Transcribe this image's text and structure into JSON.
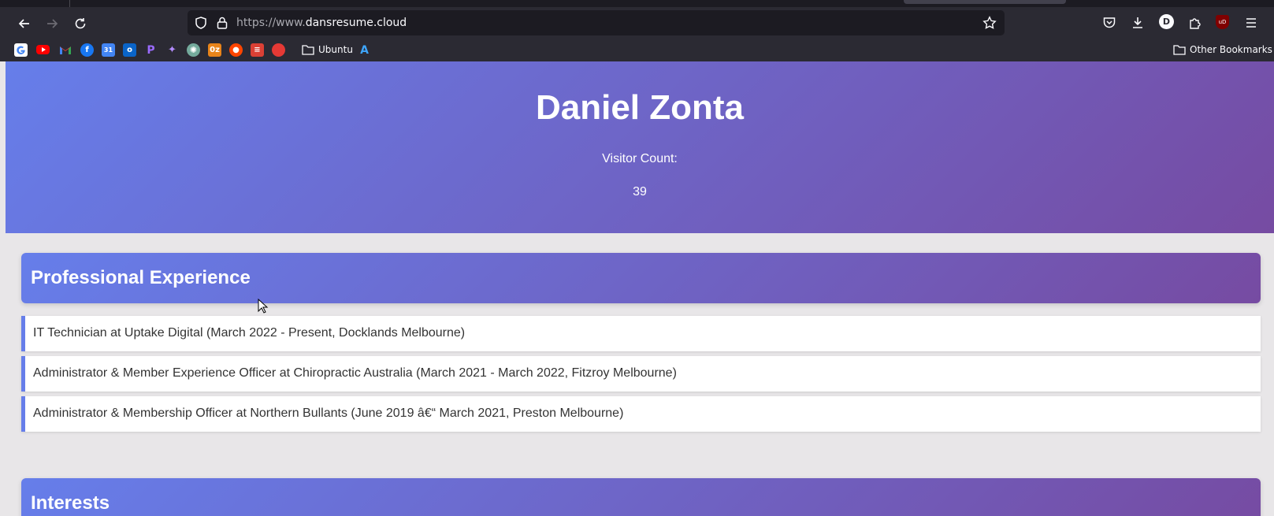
{
  "browser": {
    "url_prefix": "https://www.",
    "url_domain": "dansresume.cloud",
    "profile_initial": "D",
    "ublock_label": "uD",
    "bookmarks": {
      "folders": [
        "Ubuntu"
      ],
      "other_label": "Other Bookmarks"
    }
  },
  "hero": {
    "name": "Daniel Zonta",
    "visitor_label": "Visitor Count:",
    "visitor_count": "39"
  },
  "experience": {
    "title": "Professional Experience",
    "items": [
      "IT Technician at Uptake Digital (March 2022 - Present, Docklands Melbourne)",
      "Administrator & Member Experience Officer at Chiropractic Australia (March 2021 - March 2022, Fitzroy Melbourne)",
      "Administrator & Membership Officer at Northern Bullants (June 2019 â€“ March 2021, Preston Melbourne)"
    ]
  },
  "interests": {
    "title": "Interests"
  },
  "colors": {
    "gradient_start": "#667eea",
    "gradient_end": "#764ba2",
    "chrome_bg": "#2b2a33"
  }
}
